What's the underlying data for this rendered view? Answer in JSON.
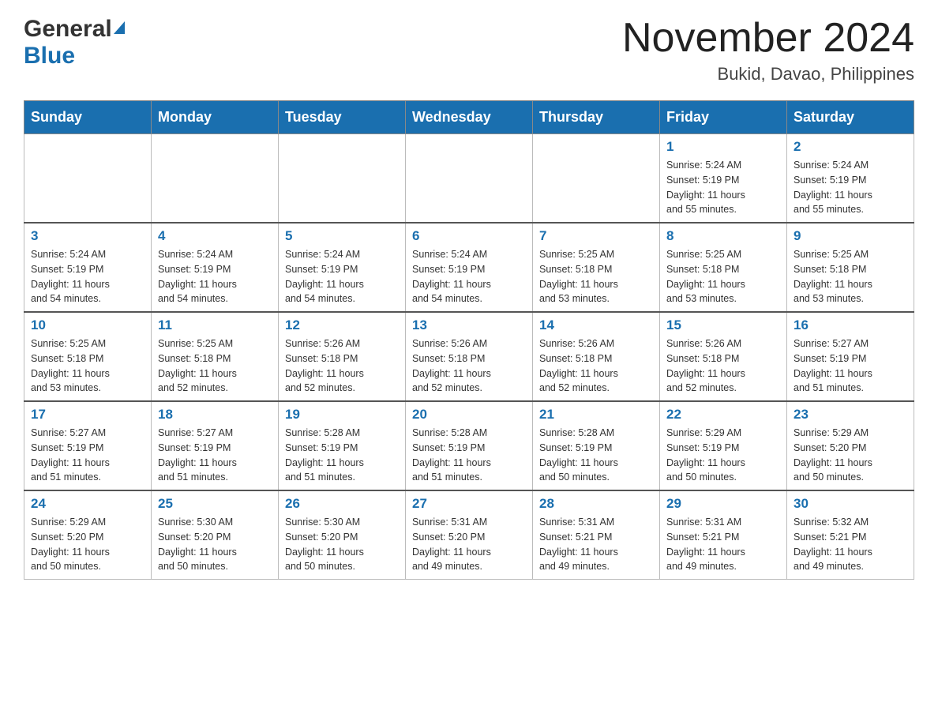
{
  "header": {
    "month_title": "November 2024",
    "location": "Bukid, Davao, Philippines",
    "logo_general": "General",
    "logo_blue": "Blue"
  },
  "weekdays": [
    "Sunday",
    "Monday",
    "Tuesday",
    "Wednesday",
    "Thursday",
    "Friday",
    "Saturday"
  ],
  "weeks": [
    [
      {
        "day": "",
        "info": ""
      },
      {
        "day": "",
        "info": ""
      },
      {
        "day": "",
        "info": ""
      },
      {
        "day": "",
        "info": ""
      },
      {
        "day": "",
        "info": ""
      },
      {
        "day": "1",
        "info": "Sunrise: 5:24 AM\nSunset: 5:19 PM\nDaylight: 11 hours\nand 55 minutes."
      },
      {
        "day": "2",
        "info": "Sunrise: 5:24 AM\nSunset: 5:19 PM\nDaylight: 11 hours\nand 55 minutes."
      }
    ],
    [
      {
        "day": "3",
        "info": "Sunrise: 5:24 AM\nSunset: 5:19 PM\nDaylight: 11 hours\nand 54 minutes."
      },
      {
        "day": "4",
        "info": "Sunrise: 5:24 AM\nSunset: 5:19 PM\nDaylight: 11 hours\nand 54 minutes."
      },
      {
        "day": "5",
        "info": "Sunrise: 5:24 AM\nSunset: 5:19 PM\nDaylight: 11 hours\nand 54 minutes."
      },
      {
        "day": "6",
        "info": "Sunrise: 5:24 AM\nSunset: 5:19 PM\nDaylight: 11 hours\nand 54 minutes."
      },
      {
        "day": "7",
        "info": "Sunrise: 5:25 AM\nSunset: 5:18 PM\nDaylight: 11 hours\nand 53 minutes."
      },
      {
        "day": "8",
        "info": "Sunrise: 5:25 AM\nSunset: 5:18 PM\nDaylight: 11 hours\nand 53 minutes."
      },
      {
        "day": "9",
        "info": "Sunrise: 5:25 AM\nSunset: 5:18 PM\nDaylight: 11 hours\nand 53 minutes."
      }
    ],
    [
      {
        "day": "10",
        "info": "Sunrise: 5:25 AM\nSunset: 5:18 PM\nDaylight: 11 hours\nand 53 minutes."
      },
      {
        "day": "11",
        "info": "Sunrise: 5:25 AM\nSunset: 5:18 PM\nDaylight: 11 hours\nand 52 minutes."
      },
      {
        "day": "12",
        "info": "Sunrise: 5:26 AM\nSunset: 5:18 PM\nDaylight: 11 hours\nand 52 minutes."
      },
      {
        "day": "13",
        "info": "Sunrise: 5:26 AM\nSunset: 5:18 PM\nDaylight: 11 hours\nand 52 minutes."
      },
      {
        "day": "14",
        "info": "Sunrise: 5:26 AM\nSunset: 5:18 PM\nDaylight: 11 hours\nand 52 minutes."
      },
      {
        "day": "15",
        "info": "Sunrise: 5:26 AM\nSunset: 5:18 PM\nDaylight: 11 hours\nand 52 minutes."
      },
      {
        "day": "16",
        "info": "Sunrise: 5:27 AM\nSunset: 5:19 PM\nDaylight: 11 hours\nand 51 minutes."
      }
    ],
    [
      {
        "day": "17",
        "info": "Sunrise: 5:27 AM\nSunset: 5:19 PM\nDaylight: 11 hours\nand 51 minutes."
      },
      {
        "day": "18",
        "info": "Sunrise: 5:27 AM\nSunset: 5:19 PM\nDaylight: 11 hours\nand 51 minutes."
      },
      {
        "day": "19",
        "info": "Sunrise: 5:28 AM\nSunset: 5:19 PM\nDaylight: 11 hours\nand 51 minutes."
      },
      {
        "day": "20",
        "info": "Sunrise: 5:28 AM\nSunset: 5:19 PM\nDaylight: 11 hours\nand 51 minutes."
      },
      {
        "day": "21",
        "info": "Sunrise: 5:28 AM\nSunset: 5:19 PM\nDaylight: 11 hours\nand 50 minutes."
      },
      {
        "day": "22",
        "info": "Sunrise: 5:29 AM\nSunset: 5:19 PM\nDaylight: 11 hours\nand 50 minutes."
      },
      {
        "day": "23",
        "info": "Sunrise: 5:29 AM\nSunset: 5:20 PM\nDaylight: 11 hours\nand 50 minutes."
      }
    ],
    [
      {
        "day": "24",
        "info": "Sunrise: 5:29 AM\nSunset: 5:20 PM\nDaylight: 11 hours\nand 50 minutes."
      },
      {
        "day": "25",
        "info": "Sunrise: 5:30 AM\nSunset: 5:20 PM\nDaylight: 11 hours\nand 50 minutes."
      },
      {
        "day": "26",
        "info": "Sunrise: 5:30 AM\nSunset: 5:20 PM\nDaylight: 11 hours\nand 50 minutes."
      },
      {
        "day": "27",
        "info": "Sunrise: 5:31 AM\nSunset: 5:20 PM\nDaylight: 11 hours\nand 49 minutes."
      },
      {
        "day": "28",
        "info": "Sunrise: 5:31 AM\nSunset: 5:21 PM\nDaylight: 11 hours\nand 49 minutes."
      },
      {
        "day": "29",
        "info": "Sunrise: 5:31 AM\nSunset: 5:21 PM\nDaylight: 11 hours\nand 49 minutes."
      },
      {
        "day": "30",
        "info": "Sunrise: 5:32 AM\nSunset: 5:21 PM\nDaylight: 11 hours\nand 49 minutes."
      }
    ]
  ]
}
